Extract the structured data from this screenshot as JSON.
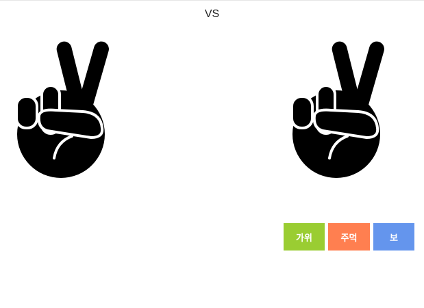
{
  "header": {
    "vs_label": "VS"
  },
  "players": {
    "left": {
      "hand_icon": "victory-hand-icon"
    },
    "right": {
      "hand_icon": "victory-hand-icon"
    }
  },
  "controls": {
    "buttons": [
      {
        "label": "가위",
        "color": "#9acd32"
      },
      {
        "label": "주먹",
        "color": "#ff7f50"
      },
      {
        "label": "보",
        "color": "#6495ed"
      }
    ]
  }
}
